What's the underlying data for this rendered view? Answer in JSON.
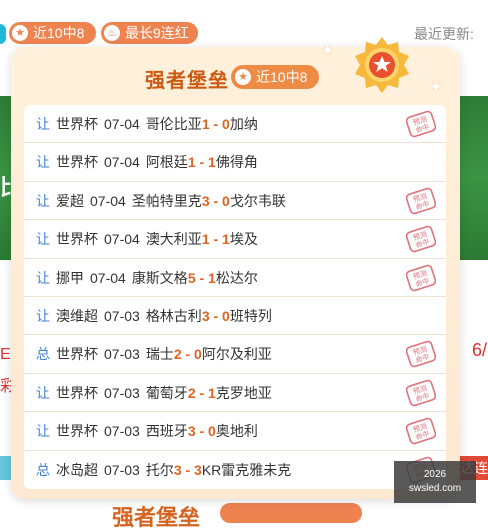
{
  "header": {
    "badge_recent": "近10中8",
    "badge_streak": "最长9连红",
    "last_update_label": "最近更新:"
  },
  "background": {
    "banner_char": "比",
    "red_left1": "E／",
    "red_left2": "彩",
    "red_right": "6/",
    "side_tab": "达连",
    "bottom_title": "强者堡垒"
  },
  "popup": {
    "title": "强者堡垒",
    "badge": "近10中8",
    "stamp_text": "预测命中",
    "rows": [
      {
        "type": "让",
        "league": "世界杯",
        "date": "07-04",
        "home": "哥伦比亚",
        "score": "1 - 0",
        "away": "加纳",
        "hit": true
      },
      {
        "type": "让",
        "league": "世界杯",
        "date": "07-04",
        "home": "阿根廷",
        "score": "1 - 1",
        "away": "佛得角",
        "hit": false
      },
      {
        "type": "让",
        "league": "爱超",
        "date": "07-04",
        "home": "圣帕特里克",
        "score": "3 - 0",
        "away": "戈尔韦联",
        "hit": true
      },
      {
        "type": "让",
        "league": "世界杯",
        "date": "07-04",
        "home": "澳大利亚",
        "score": "1 - 1",
        "away": "埃及",
        "hit": true
      },
      {
        "type": "让",
        "league": "挪甲",
        "date": "07-04",
        "home": "康斯文格",
        "score": "5 - 1",
        "away": "松达尔",
        "hit": true
      },
      {
        "type": "让",
        "league": "澳维超",
        "date": "07-03",
        "home": "格林古利",
        "score": "3 - 0",
        "away": "班特列",
        "hit": false
      },
      {
        "type": "总",
        "league": "世界杯",
        "date": "07-03",
        "home": "瑞士",
        "score": "2 - 0",
        "away": "阿尔及利亚",
        "hit": true
      },
      {
        "type": "让",
        "league": "世界杯",
        "date": "07-03",
        "home": "葡萄牙",
        "score": "2 - 1",
        "away": "克罗地亚",
        "hit": true
      },
      {
        "type": "让",
        "league": "世界杯",
        "date": "07-03",
        "home": "西班牙",
        "score": "3 - 0",
        "away": "奥地利",
        "hit": true
      },
      {
        "type": "总",
        "league": "冰岛超",
        "date": "07-03",
        "home": "托尔",
        "score": "3 - 3",
        "away": "KR雷克雅未克",
        "hit": true
      }
    ]
  },
  "watermark": {
    "line1": "2026",
    "line2": "swsled.com"
  },
  "colors": {
    "accent": "#ee8350",
    "title": "#cc5a13",
    "score": "#e0631f",
    "type_label": "#3d83d8",
    "stamp": "#e2707a"
  }
}
